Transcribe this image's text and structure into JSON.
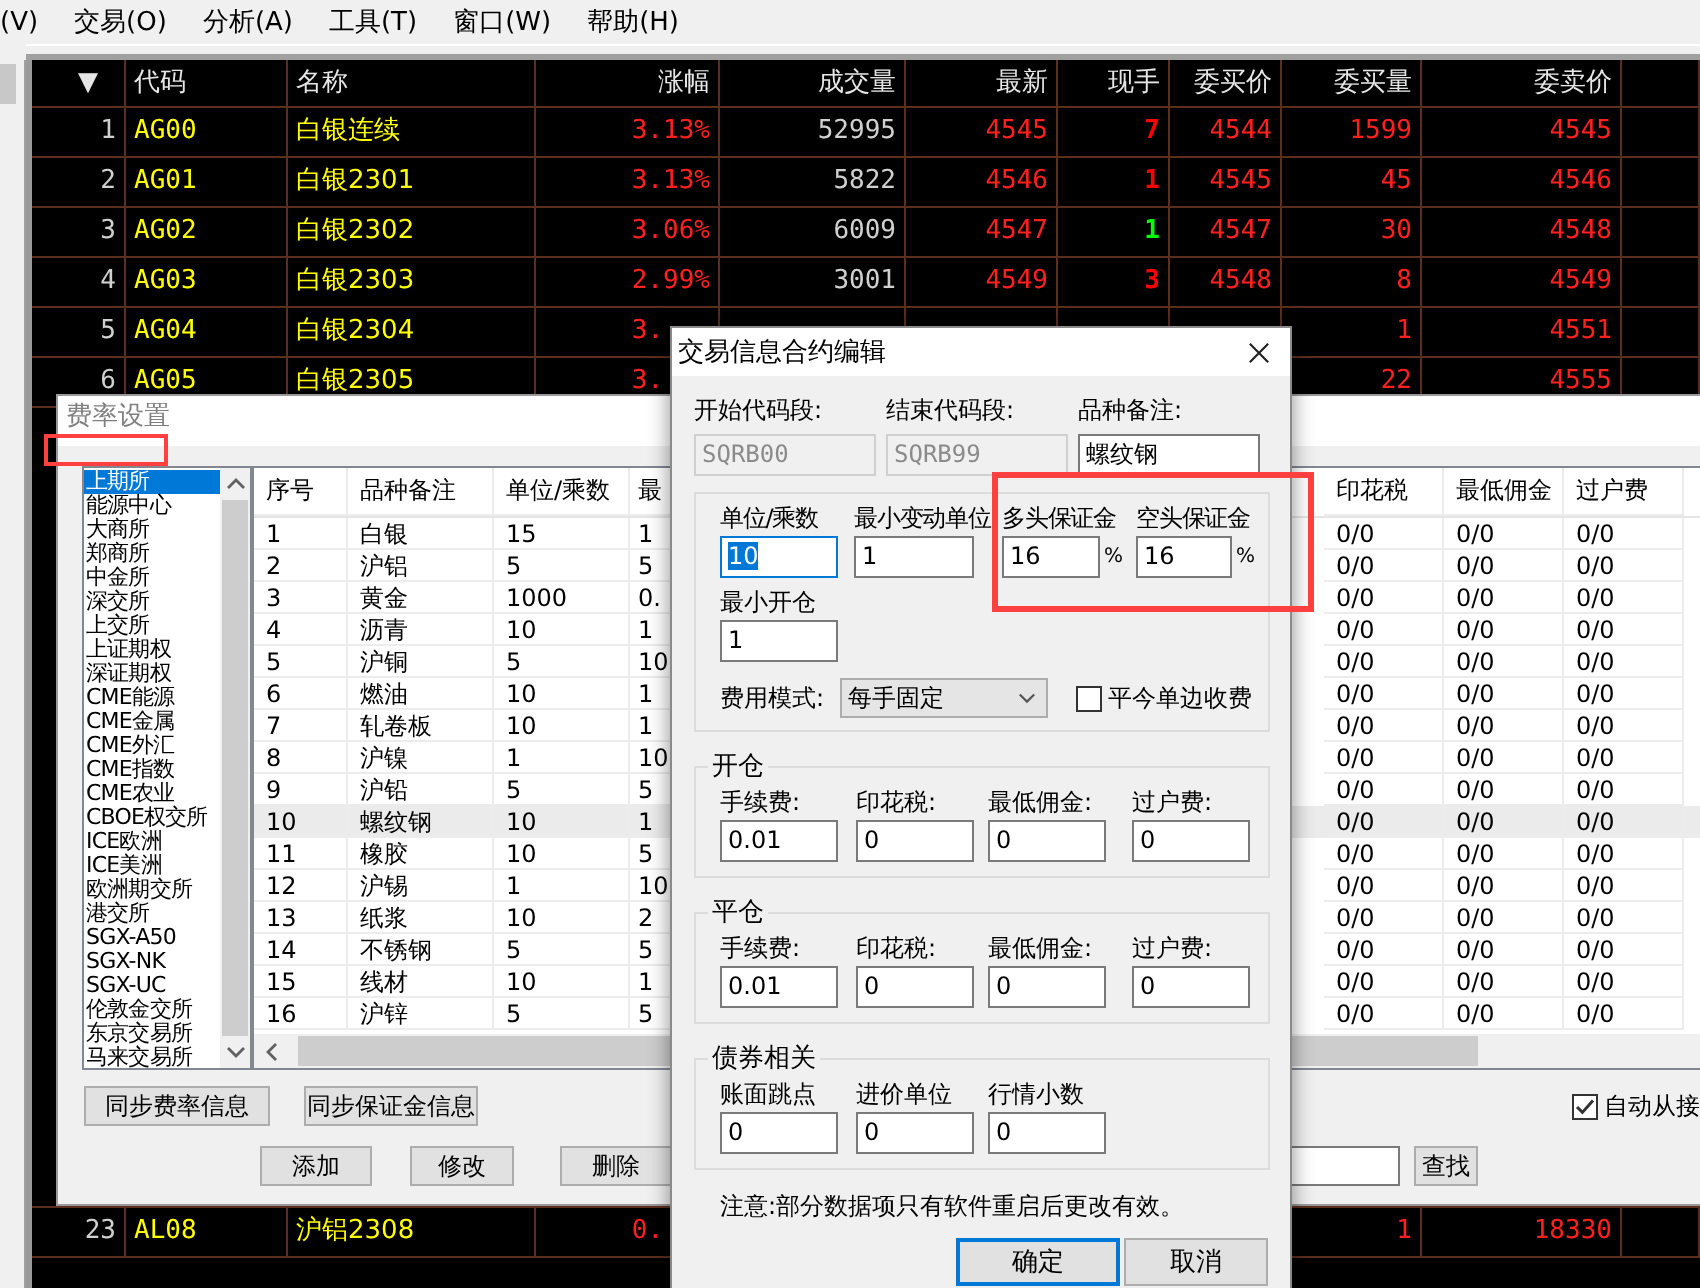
{
  "menu": [
    "(V)",
    "交易(O)",
    "分析(A)",
    "工具(T)",
    "窗口(W)",
    "帮助(H)"
  ],
  "quote_table": {
    "columns": [
      "▼",
      "代码",
      "名称",
      "涨幅",
      "成交量",
      "最新",
      "现手",
      "委买价",
      "委买量",
      "委卖价"
    ],
    "rows": [
      {
        "num": "1",
        "code": "AG00",
        "name": "白银连续",
        "change": "3.13%",
        "volume": "52995",
        "last": "4545",
        "hand": {
          "text": "7",
          "color": "#ff0000"
        },
        "bid": "4544",
        "bid_qty": "1599",
        "ask": "4545"
      },
      {
        "num": "2",
        "code": "AG01",
        "name": "白银2301",
        "change": "3.13%",
        "volume": "5822",
        "last": "4546",
        "hand": {
          "text": "1",
          "color": "#ff0000"
        },
        "bid": "4545",
        "bid_qty": "45",
        "ask": "4546"
      },
      {
        "num": "3",
        "code": "AG02",
        "name": "白银2302",
        "change": "3.06%",
        "volume": "6009",
        "last": "4547",
        "hand": {
          "text": "1",
          "color": "#00ff00"
        },
        "bid": "4547",
        "bid_qty": "30",
        "ask": "4548"
      },
      {
        "num": "4",
        "code": "AG03",
        "name": "白银2303",
        "change": "2.99%",
        "volume": "3001",
        "last": "4549",
        "hand": {
          "text": "3",
          "color": "#ff0000"
        },
        "bid": "4548",
        "bid_qty": "8",
        "ask": "4549"
      },
      {
        "num": "5",
        "code": "AG04",
        "name": "白银2304",
        "change": "3.",
        "clipped": true,
        "bid_qty": "1",
        "ask": "4551"
      },
      {
        "num": "6",
        "code": "AG05",
        "name": "白银2305",
        "change": "3.",
        "clipped": true,
        "bid_qty": "22",
        "ask": "4555"
      }
    ],
    "bottom_rows": [
      {
        "num": "23",
        "code": "AL08",
        "name": "沪铝2308",
        "change": "0.",
        "clipped": true,
        "bid_qty": "1",
        "ask": "18330"
      }
    ]
  },
  "fee_dialog": {
    "title": "费率设置",
    "exchanges": [
      {
        "label": "上期所",
        "selected": true
      },
      {
        "label": "能源中心",
        "selected": false
      },
      {
        "label": "大商所",
        "selected": false
      },
      {
        "label": "郑商所",
        "selected": false
      },
      {
        "label": "中金所",
        "selected": false
      },
      {
        "label": "深交所",
        "selected": false
      },
      {
        "label": "上交所",
        "selected": false
      },
      {
        "label": "上证期权",
        "selected": false
      },
      {
        "label": "深证期权",
        "selected": false
      },
      {
        "label": "CME能源",
        "selected": false
      },
      {
        "label": "CME金属",
        "selected": false
      },
      {
        "label": "CME外汇",
        "selected": false
      },
      {
        "label": "CME指数",
        "selected": false
      },
      {
        "label": "CME农业",
        "selected": false
      },
      {
        "label": "CBOE权交所",
        "selected": false
      },
      {
        "label": "ICE欧洲",
        "selected": false
      },
      {
        "label": "ICE美洲",
        "selected": false
      },
      {
        "label": "欧洲期交所",
        "selected": false
      },
      {
        "label": "港交所",
        "selected": false
      },
      {
        "label": "SGX-A50",
        "selected": false
      },
      {
        "label": "SGX-NK",
        "selected": false
      },
      {
        "label": "SGX-UC",
        "selected": false
      },
      {
        "label": "伦敦金交所",
        "selected": false
      },
      {
        "label": "东京交易所",
        "selected": false
      },
      {
        "label": "马来交易所",
        "selected": false
      }
    ],
    "columns": [
      "序号",
      "品种备注",
      "单位/乘数",
      "最",
      "印花税",
      "最低佣金",
      "过户费"
    ],
    "rows": [
      {
        "cells": [
          "1",
          "白银",
          "15",
          "1",
          "0/0",
          "0/0",
          "0/0"
        ],
        "selected": false
      },
      {
        "cells": [
          "2",
          "沪铝",
          "5",
          "5",
          "0/0",
          "0/0",
          "0/0"
        ],
        "selected": false
      },
      {
        "cells": [
          "3",
          "黄金",
          "1000",
          "0.",
          "0/0",
          "0/0",
          "0/0"
        ],
        "selected": false
      },
      {
        "cells": [
          "4",
          "沥青",
          "10",
          "1",
          "0/0",
          "0/0",
          "0/0"
        ],
        "selected": false
      },
      {
        "cells": [
          "5",
          "沪铜",
          "5",
          "10",
          "0/0",
          "0/0",
          "0/0"
        ],
        "selected": false
      },
      {
        "cells": [
          "6",
          "燃油",
          "10",
          "1",
          "0/0",
          "0/0",
          "0/0"
        ],
        "selected": false
      },
      {
        "cells": [
          "7",
          "轧卷板",
          "10",
          "1",
          "0/0",
          "0/0",
          "0/0"
        ],
        "selected": false
      },
      {
        "cells": [
          "8",
          "沪镍",
          "1",
          "10",
          "0/0",
          "0/0",
          "0/0"
        ],
        "selected": false
      },
      {
        "cells": [
          "9",
          "沪铅",
          "5",
          "5",
          "0/0",
          "0/0",
          "0/0"
        ],
        "selected": false
      },
      {
        "cells": [
          "10",
          "螺纹钢",
          "10",
          "1",
          "0/0",
          "0/0",
          "0/0"
        ],
        "selected": true
      },
      {
        "cells": [
          "11",
          "橡胶",
          "10",
          "5",
          "0/0",
          "0/0",
          "0/0"
        ],
        "selected": false
      },
      {
        "cells": [
          "12",
          "沪锡",
          "1",
          "10",
          "0/0",
          "0/0",
          "0/0"
        ],
        "selected": false
      },
      {
        "cells": [
          "13",
          "纸浆",
          "10",
          "2",
          "0/0",
          "0/0",
          "0/0"
        ],
        "selected": false
      },
      {
        "cells": [
          "14",
          "不锈钢",
          "5",
          "5",
          "0/0",
          "0/0",
          "0/0"
        ],
        "selected": false
      },
      {
        "cells": [
          "15",
          "线材",
          "10",
          "1",
          "0/0",
          "0/0",
          "0/0"
        ],
        "selected": false
      },
      {
        "cells": [
          "16",
          "沪锌",
          "5",
          "5",
          "0/0",
          "0/0",
          "0/0"
        ],
        "selected": false
      }
    ],
    "sync_buttons": [
      "同步费率信息",
      "同步保证金信息"
    ],
    "auto_sync": {
      "label": "自动从接",
      "checked": true
    },
    "actions": [
      "添加",
      "修改",
      "删除"
    ],
    "search_button": "查找"
  },
  "edit_dialog": {
    "title": "交易信息合约编辑",
    "code_fields": [
      {
        "label": "开始代码段:",
        "value": "SQRB00",
        "disabled": true
      },
      {
        "label": "结束代码段:",
        "value": "SQRB99",
        "disabled": true
      },
      {
        "label": "品种备注:",
        "value": "螺纹钢",
        "disabled": false
      }
    ],
    "unit_fields": [
      {
        "label": "单位/乘数",
        "value": "10",
        "focused": true
      },
      {
        "label": "最小变动单位",
        "value": "1",
        "focused": false
      },
      {
        "label": "多头保证金",
        "value": "16",
        "focused": false,
        "unit": "%"
      },
      {
        "label": "空头保证金",
        "value": "16",
        "focused": false,
        "unit": "%"
      }
    ],
    "min_open": {
      "label": "最小开仓",
      "value": "1"
    },
    "fee_mode": {
      "label": "费用模式:",
      "value": "每手固定"
    },
    "one_side": {
      "label": "平今单边收费",
      "checked": false
    },
    "groups": [
      {
        "title": "开仓",
        "fields": [
          {
            "label": "手续费:",
            "value": "0.01"
          },
          {
            "label": "印花税:",
            "value": "0"
          },
          {
            "label": "最低佣金:",
            "value": "0"
          },
          {
            "label": "过户费:",
            "value": "0"
          }
        ]
      },
      {
        "title": "平仓",
        "fields": [
          {
            "label": "手续费:",
            "value": "0.01"
          },
          {
            "label": "印花税:",
            "value": "0"
          },
          {
            "label": "最低佣金:",
            "value": "0"
          },
          {
            "label": "过户费:",
            "value": "0"
          }
        ]
      },
      {
        "title": "债券相关",
        "fields": [
          {
            "label": "账面跳点",
            "value": "0"
          },
          {
            "label": "进价单位",
            "value": "0"
          },
          {
            "label": "行情小数",
            "value": "0"
          }
        ]
      }
    ],
    "note": "注意:部分数据项只有软件重启后更改有效。",
    "buttons": [
      {
        "label": "确定",
        "default": true
      },
      {
        "label": "取消",
        "default": false
      }
    ]
  }
}
